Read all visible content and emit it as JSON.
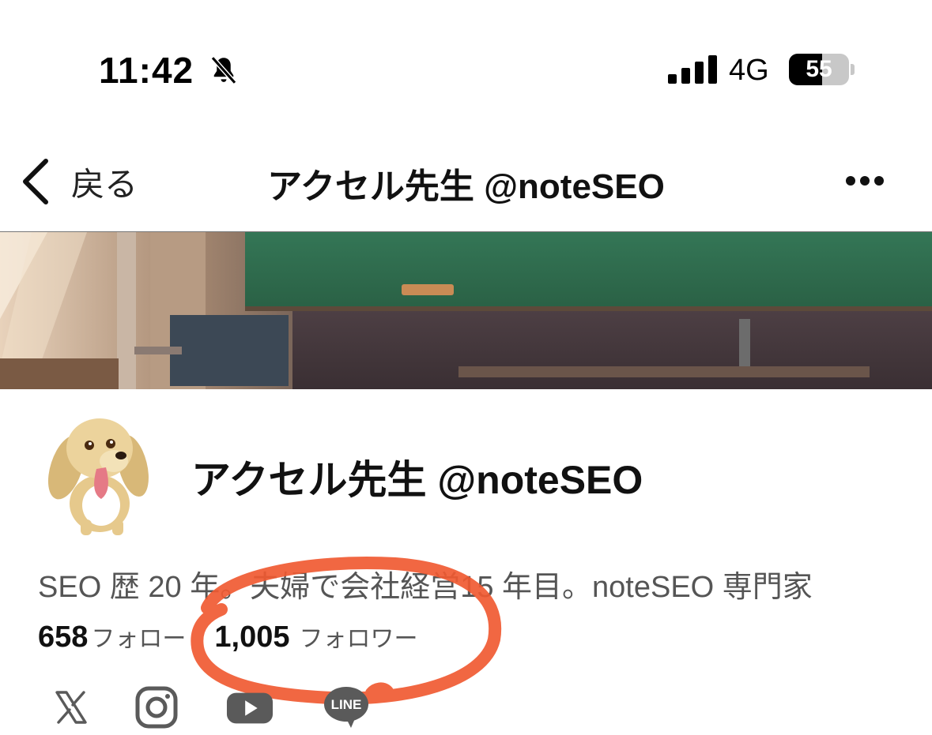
{
  "status_bar": {
    "time": "11:42",
    "network": "4G",
    "battery": "55",
    "battery_level": 0.55,
    "icons": [
      "bell-slash-icon",
      "cellular-signal-icon",
      "battery-icon"
    ]
  },
  "nav": {
    "back_label": "戻る",
    "title": "アクセル先生 @noteSEO",
    "more_icon": "more-horizontal-icon"
  },
  "profile": {
    "name": "アクセル先生 @noteSEO",
    "bio": "SEO 歴 20 年。夫婦で会社経営15 年目。noteSEO 専門家",
    "following_count": "658",
    "following_label": "フォロー",
    "followers_count": "1,005",
    "followers_label": "フォロワー"
  },
  "social_links": [
    {
      "icon": "x-icon"
    },
    {
      "icon": "instagram-icon"
    },
    {
      "icon": "youtube-icon"
    },
    {
      "icon": "line-icon",
      "text": "LINE"
    }
  ],
  "colors": {
    "annotation": "#f05a32",
    "chalkboard": "#2d6a4a",
    "icon_gray": "#5a5a5a"
  }
}
